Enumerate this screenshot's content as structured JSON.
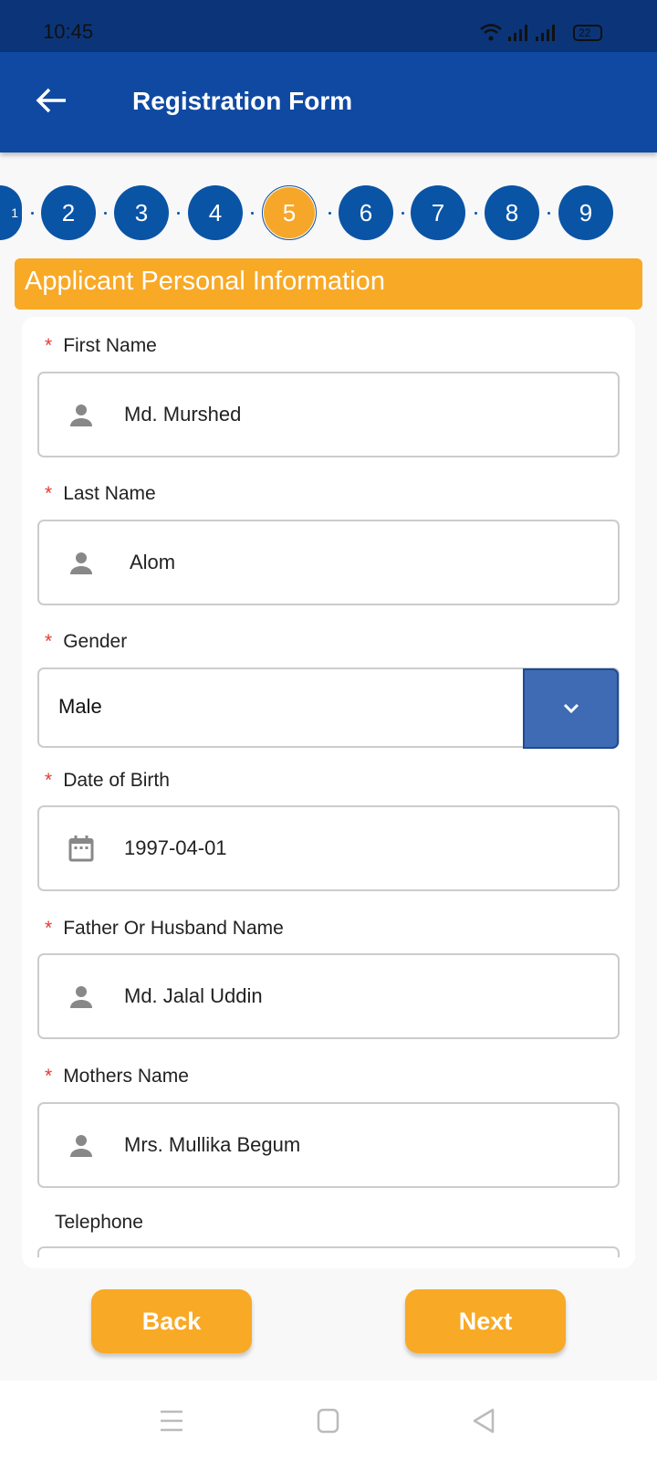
{
  "status_bar": {
    "time": "10:45",
    "battery": "22"
  },
  "app_bar": {
    "title": "Registration Form"
  },
  "stepper": {
    "steps": [
      "1",
      "2",
      "3",
      "4",
      "5",
      "6",
      "7",
      "8",
      "9"
    ],
    "current": "5",
    "active_color": "#f6a72a",
    "color": "#0a54a6"
  },
  "section": {
    "title": "Applicant Personal Information"
  },
  "form": {
    "required_mark": "*",
    "first_name": {
      "label": "First Name",
      "value": "Md. Murshed"
    },
    "last_name": {
      "label": "Last Name",
      "value": "Alom"
    },
    "gender": {
      "label": "Gender",
      "value": "Male"
    },
    "dob": {
      "label": "Date of Birth",
      "value": "1997-04-01"
    },
    "father": {
      "label": "Father Or Husband Name",
      "value": "Md. Jalal Uddin"
    },
    "mother": {
      "label": "Mothers Name",
      "value": "Mrs. Mullika Begum"
    },
    "telephone": {
      "label": "Telephone",
      "value": ""
    }
  },
  "buttons": {
    "back": "Back",
    "next": "Next"
  }
}
